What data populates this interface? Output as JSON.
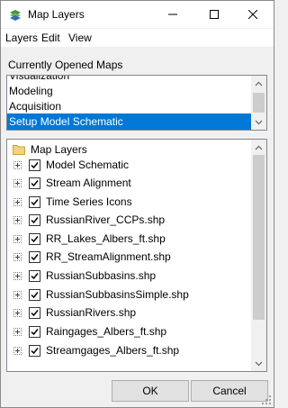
{
  "window": {
    "title": "Map Layers",
    "icon": "map-layers-app-icon"
  },
  "menu": [
    "Layers",
    "Edit",
    "View"
  ],
  "maps_section": {
    "label": "Currently Opened Maps",
    "items": [
      {
        "label": "Visualization",
        "selected": false
      },
      {
        "label": "Modeling",
        "selected": false
      },
      {
        "label": "Acquisition",
        "selected": false
      },
      {
        "label": "Setup Model Schematic",
        "selected": true
      }
    ]
  },
  "tree": {
    "root_label": "Map Layers",
    "layers": [
      {
        "label": "Model Schematic",
        "checked": true
      },
      {
        "label": "Stream Alignment",
        "checked": true
      },
      {
        "label": "Time Series Icons",
        "checked": true
      },
      {
        "label": "RussianRiver_CCPs.shp",
        "checked": true
      },
      {
        "label": "RR_Lakes_Albers_ft.shp",
        "checked": true
      },
      {
        "label": "RR_StreamAlignment.shp",
        "checked": true
      },
      {
        "label": "RussianSubbasins.shp",
        "checked": true
      },
      {
        "label": "RussianSubbasinsSimple.shp",
        "checked": true
      },
      {
        "label": "RussianRivers.shp",
        "checked": true
      },
      {
        "label": "Raingages_Albers_ft.shp",
        "checked": true
      },
      {
        "label": "Streamgages_Albers_ft.shp",
        "checked": true
      }
    ]
  },
  "buttons": {
    "ok": "OK",
    "cancel": "Cancel"
  },
  "colors": {
    "selection": "#0078d7",
    "folder": "#f3d27a"
  }
}
